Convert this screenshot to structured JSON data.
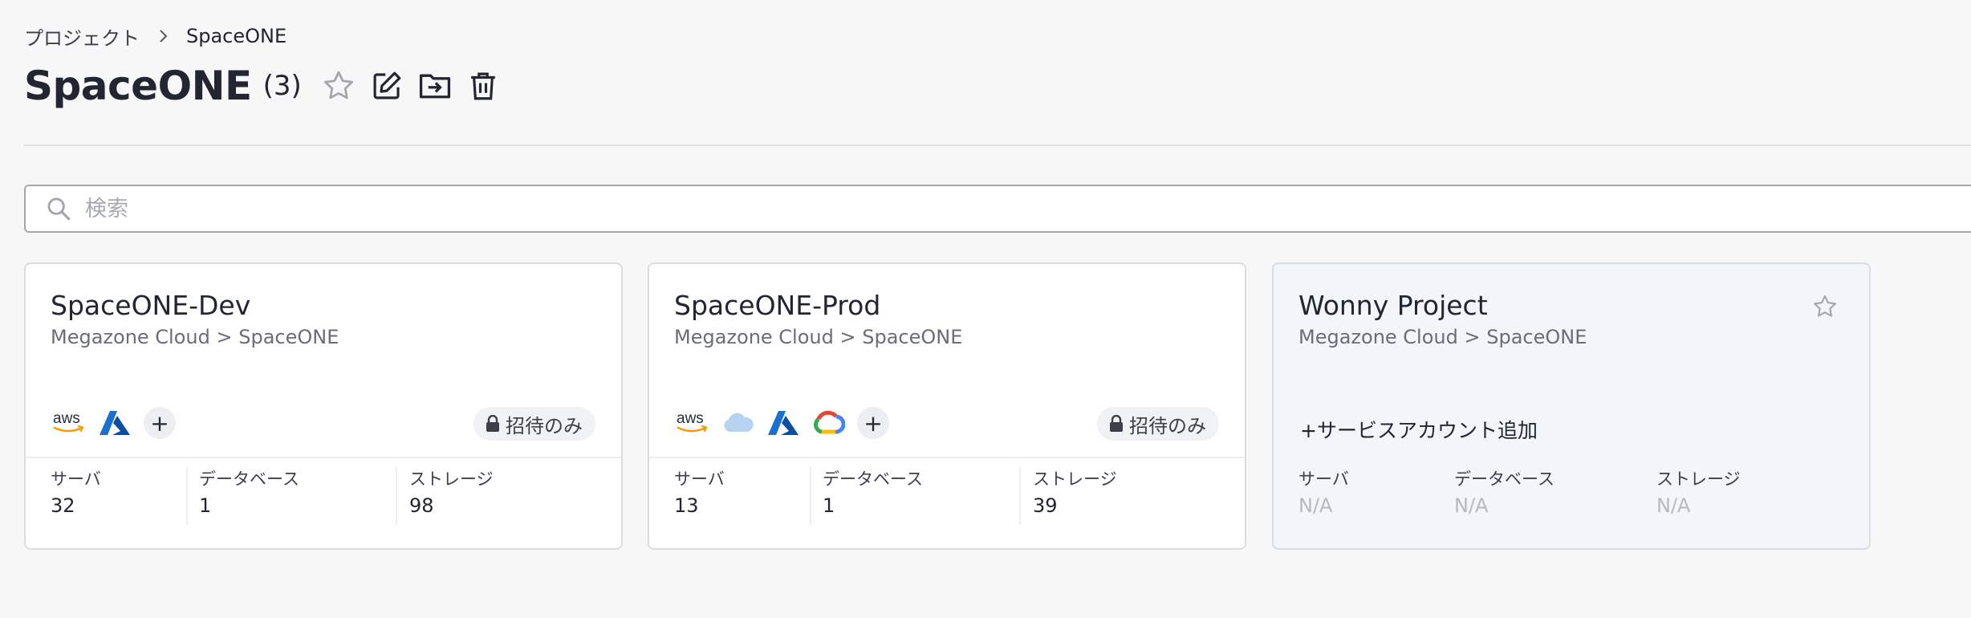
{
  "breadcrumb": {
    "root": "プロジェクト",
    "current": "SpaceONE"
  },
  "header": {
    "title": "SpaceONE",
    "count": "(3)"
  },
  "search": {
    "placeholder": "検索",
    "value": ""
  },
  "stat_labels": {
    "server": "サーバ",
    "database": "データベース",
    "storage": "ストレージ"
  },
  "cards": [
    {
      "name": "SpaceONE-Dev",
      "path": "Megazone Cloud > SpaceONE",
      "providers": [
        "aws-icon",
        "azure-icon"
      ],
      "badge": "招待のみ",
      "stats": {
        "server": "32",
        "database": "1",
        "storage": "98"
      }
    },
    {
      "name": "SpaceONE-Prod",
      "path": "Megazone Cloud > SpaceONE",
      "providers": [
        "aws-icon",
        "cloud-icon",
        "azure-icon",
        "google-cloud-icon"
      ],
      "badge": "招待のみ",
      "stats": {
        "server": "13",
        "database": "1",
        "storage": "39"
      }
    },
    {
      "name": "Wonny Project",
      "path": "Megazone Cloud > SpaceONE",
      "add_service": "+サービスアカウント追加",
      "stats": {
        "server": "N/A",
        "database": "N/A",
        "storage": "N/A"
      }
    }
  ],
  "colors": {
    "background": "#f7f7f7",
    "card": "#ffffff",
    "card_highlight": "#f2f5fa",
    "aws_orange": "#ff9900",
    "azure_blue": "#0a5ec9",
    "text_primary": "#222532",
    "text_muted": "#6a6d78"
  }
}
